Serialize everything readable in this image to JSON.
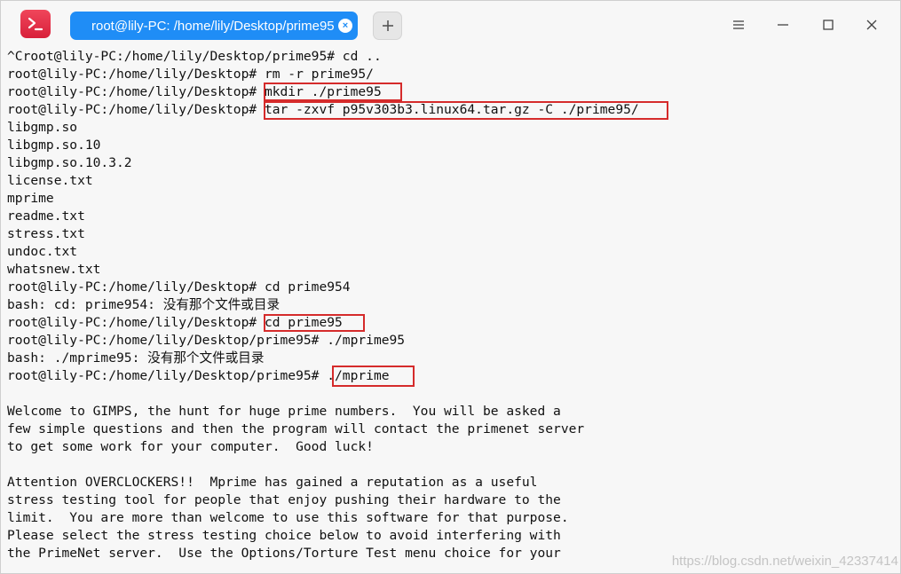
{
  "titlebar": {
    "app_icon": "terminal-icon",
    "tab_title": "root@lily-PC: /home/lily/Desktop/prime95",
    "tab_close_glyph": "×",
    "new_tab_icon": "plus-icon",
    "menu_icon": "hamburger-menu-icon",
    "minimize_icon": "minimize-icon",
    "maximize_icon": "maximize-icon",
    "close_icon": "close-icon"
  },
  "terminal": {
    "lines": [
      "^Croot@lily-PC:/home/lily/Desktop/prime95# cd ..",
      "root@lily-PC:/home/lily/Desktop# rm -r prime95/",
      "root@lily-PC:/home/lily/Desktop# mkdir ./prime95",
      "root@lily-PC:/home/lily/Desktop# tar -zxvf p95v303b3.linux64.tar.gz -C ./prime95/",
      "libgmp.so",
      "libgmp.so.10",
      "libgmp.so.10.3.2",
      "license.txt",
      "mprime",
      "readme.txt",
      "stress.txt",
      "undoc.txt",
      "whatsnew.txt",
      "root@lily-PC:/home/lily/Desktop# cd prime954",
      "bash: cd: prime954: 没有那个文件或目录",
      "root@lily-PC:/home/lily/Desktop# cd prime95",
      "root@lily-PC:/home/lily/Desktop/prime95# ./mprime95",
      "bash: ./mprime95: 没有那个文件或目录",
      "root@lily-PC:/home/lily/Desktop/prime95# ./mprime",
      "",
      "Welcome to GIMPS, the hunt for huge prime numbers.  You will be asked a",
      "few simple questions and then the program will contact the primenet server",
      "to get some work for your computer.  Good luck!",
      "",
      "Attention OVERCLOCKERS!!  Mprime has gained a reputation as a useful",
      "stress testing tool for people that enjoy pushing their hardware to the",
      "limit.  You are more than welcome to use this software for that purpose.",
      "Please select the stress testing choice below to avoid interfering with",
      "the PrimeNet server.  Use the Options/Torture Test menu choice for your"
    ]
  },
  "highlights": [
    {
      "label": "mkdir ./prime95"
    },
    {
      "label": "tar -zxvf p95v303b3.linux64.tar.gz -C ./prime95/"
    },
    {
      "label": "cd prime95"
    },
    {
      "label": "./mprime"
    }
  ],
  "colors": {
    "accent_tab": "#1f8df6",
    "app_icon": "#e0283f",
    "highlight_box": "#d52b2b",
    "terminal_bg": "#f7f7f7",
    "terminal_fg": "#111111"
  },
  "watermark": "https://blog.csdn.net/weixin_42337414"
}
